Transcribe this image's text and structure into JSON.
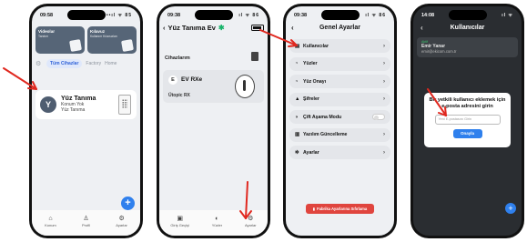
{
  "colors": {
    "accent": "#2f80ed",
    "arrow": "#e0281f",
    "danger": "#e0453e",
    "promo": "#566577"
  },
  "phone1": {
    "time": "09:58",
    "signal": "••ıl ᯤ 85",
    "cards": [
      {
        "title": "Videolar",
        "subtitle": "Tanıtım"
      },
      {
        "title": "Kılavuz",
        "subtitle": "Kullanım Kılavuzları"
      }
    ],
    "filters": [
      "Tüm Cihazlar",
      "Factory",
      "Home"
    ],
    "device": {
      "initial": "Y",
      "name": "Yüz Tanıma",
      "location": "Konum Yok",
      "type": "Yüz Tanıma"
    },
    "fab_label": "+",
    "tabs": [
      {
        "icon": "⌂",
        "label": "Konum"
      },
      {
        "icon": "♙",
        "label": "Profil"
      },
      {
        "icon": "⚙",
        "label": "Ayarlar"
      }
    ]
  },
  "phone2": {
    "time": "09:38",
    "signal": "ıl ᯤ 86",
    "back": "‹",
    "title": "Yüz Tanıma Ev",
    "section": "Cihazlarım",
    "device": {
      "initial": "E",
      "name": "EV RXe",
      "label": "Ütopic RX"
    },
    "tabs": [
      {
        "icon": "▣",
        "label": "Giriş Geçişi"
      },
      {
        "icon": "◐",
        "label": "Yüzler"
      },
      {
        "icon": "⚙",
        "label": "Ayarlar"
      }
    ]
  },
  "phone3": {
    "time": "09:38",
    "signal": "ıl ᯤ 86",
    "back": "‹",
    "title": "Genel Ayarlar",
    "menu": [
      {
        "icon": "▤",
        "label": "Kullanıcılar"
      },
      {
        "icon": "◔",
        "label": "Yüzler"
      },
      {
        "icon": "◔",
        "label": "Yüz Onayı"
      },
      {
        "icon": "▲",
        "label": "Şifreler"
      },
      {
        "icon": "◑",
        "label": "Çift Aşama Modu",
        "toggle": true
      },
      {
        "icon": "▥",
        "label": "Yazılım Güncelleme"
      },
      {
        "icon": "✲",
        "label": "Ayarlar"
      }
    ],
    "reset_label": "Fabrika Ayarlarına Sıfırlama"
  },
  "phone4": {
    "time": "14:08",
    "signal": "ıl ᯤ",
    "back": "‹",
    "title": "Kullanıcılar",
    "user": {
      "status": "Aktif",
      "name": "Emir Yanar",
      "email": "emir@ekicom.com.tr"
    },
    "modal": {
      "question": "Bir yetkili kullanıcı eklemek için e-posta adresini girin",
      "placeholder": "Yeni E-postasını Girin",
      "button": "Onayla"
    },
    "fab_label": "+"
  }
}
